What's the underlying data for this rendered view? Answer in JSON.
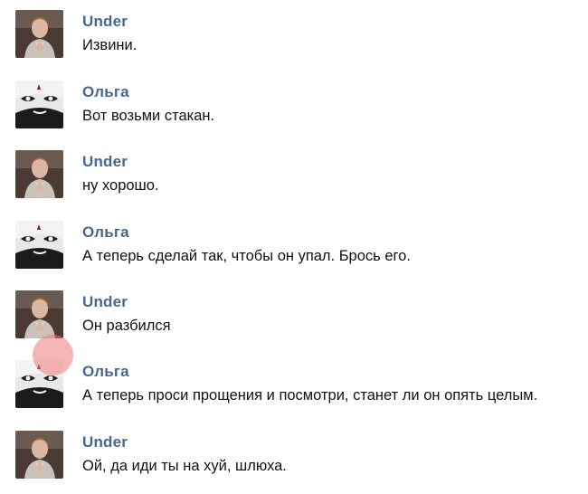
{
  "messages": [
    {
      "author": "Under",
      "text": "Извини.",
      "avatar": "under-avatar"
    },
    {
      "author": "Ольга",
      "text": "Вот возьми стакан.",
      "avatar": "olga-avatar"
    },
    {
      "author": "Under",
      "text": "ну хорошо.",
      "avatar": "under-avatar"
    },
    {
      "author": "Ольга",
      "text": "А теперь сделай так, чтобы он упал. Брось его.",
      "avatar": "olga-avatar"
    },
    {
      "author": "Under",
      "text": "Он разбился",
      "avatar": "under-avatar"
    },
    {
      "author": "Ольга",
      "text": "А теперь проси прощения и посмотри, станет ли он опять целым.",
      "avatar": "olga-avatar"
    },
    {
      "author": "Under",
      "text": "Ой, да иди ты на хуй, шлюха.",
      "avatar": "under-avatar"
    }
  ],
  "colors": {
    "author_link": "#45688e",
    "message_text": "#111111",
    "background": "#ffffff",
    "touch_indicator": "#ec7878"
  }
}
